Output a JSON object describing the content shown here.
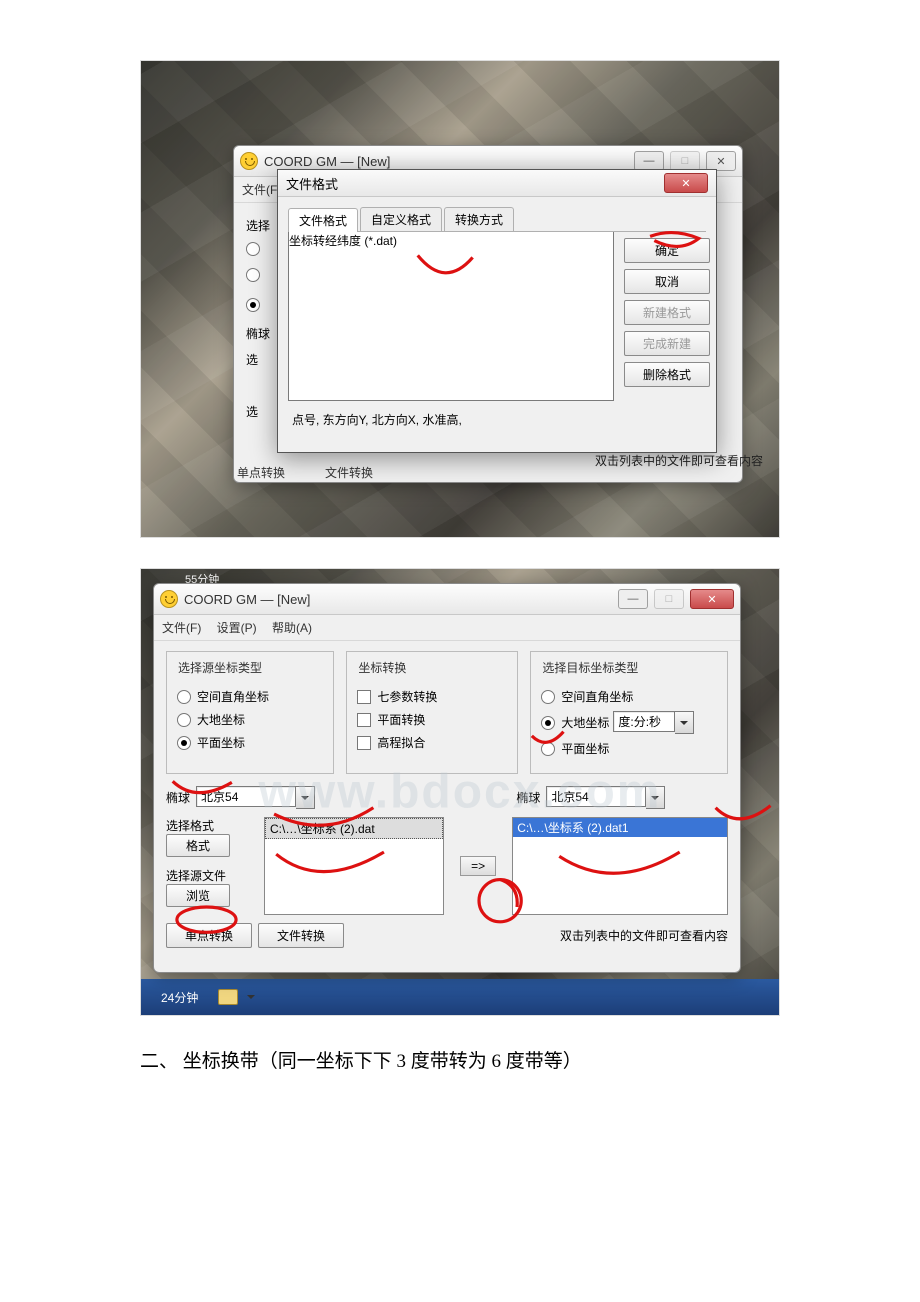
{
  "shot1": {
    "main": {
      "title": "COORD GM — [New]",
      "menu": {
        "file": "文件(F)"
      },
      "source_legend": "选择",
      "ellipsoid_label": "椭球",
      "select_label_a": "选",
      "select_label_b": "选",
      "status_hint": "双击列表中的文件即可查看内容",
      "bottom_a": "单点转换",
      "bottom_b": "文件转换"
    },
    "modal": {
      "title": "文件格式",
      "tabs": {
        "a": "文件格式",
        "b": "自定义格式",
        "c": "转换方式"
      },
      "item": "坐标转经纬度 (*.dat)",
      "footer": "点号, 东方向Y, 北方向X, 水准高,",
      "btn_ok": "确定",
      "btn_cancel": "取消",
      "btn_new": "新建格式",
      "btn_done": "完成新建",
      "btn_del": "删除格式"
    }
  },
  "shot2": {
    "title": "COORD GM — [New]",
    "minutes_top": "55分钟",
    "minutes_bottom": "24分钟",
    "menu": {
      "file": "文件(F)",
      "set": "设置(P)",
      "help": "帮助(A)"
    },
    "source": {
      "legend": "选择源坐标类型",
      "r1": "空间直角坐标",
      "r2": "大地坐标",
      "r3": "平面坐标"
    },
    "conv": {
      "legend": "坐标转换",
      "c1": "七参数转换",
      "c2": "平面转换",
      "c3": "高程拟合"
    },
    "target": {
      "legend": "选择目标坐标类型",
      "r1": "空间直角坐标",
      "r2": "大地坐标",
      "r2_fmt": "度:分:秒",
      "r3": "平面坐标"
    },
    "ellipsoid_label": "椭球",
    "ellipsoid_val": "北京54",
    "format_label": "选择格式",
    "format_btn": "格式",
    "srcfile_label": "选择源文件",
    "browse_btn": "浏览",
    "src_file": "C:\\…\\坐标系 (2).dat",
    "tgt_file": "C:\\…\\坐标系 (2).dat1",
    "arrow_btn": "=>",
    "bottom_a": "单点转换",
    "bottom_b": "文件转换",
    "hint": "双击列表中的文件即可查看内容"
  },
  "watermark": "www.bdocx.com",
  "caption": "二、 坐标换带（同一坐标下下 3 度带转为 6 度带等）"
}
